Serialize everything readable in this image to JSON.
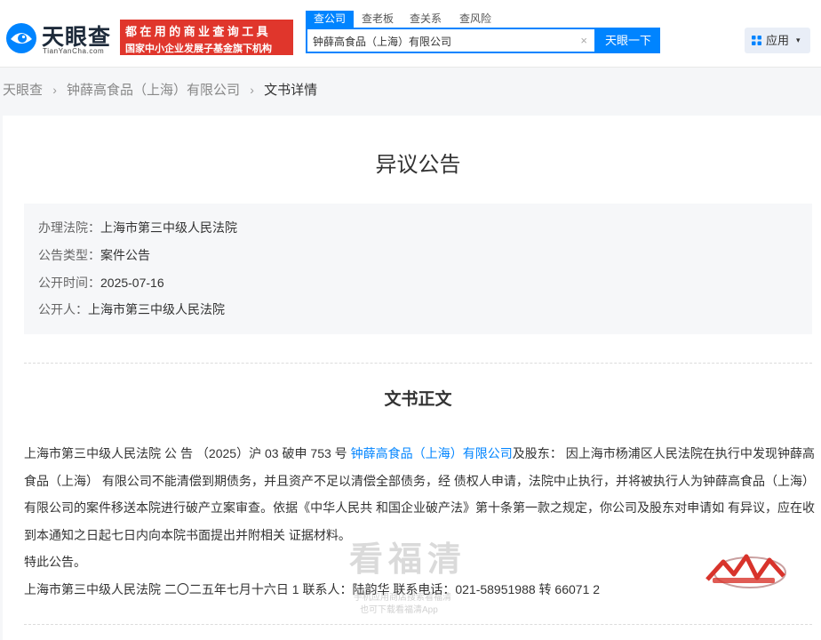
{
  "header": {
    "logo_text": "天眼查",
    "logo_sub": "TianYanCha.com",
    "slogan_line1": "都在用的商业查询工具",
    "slogan_line2": "国家中小企业发展子基金旗下机构",
    "search_tabs": [
      {
        "label": "查公司"
      },
      {
        "label": "查老板"
      },
      {
        "label": "查关系"
      },
      {
        "label": "查风险"
      }
    ],
    "search_value": "钟薛高食品（上海）有限公司",
    "clear_glyph": "×",
    "search_button": "天眼一下",
    "apps_button": "应用",
    "apps_caret": "▾"
  },
  "breadcrumb": {
    "items": [
      "天眼查",
      "钟薛高食品（上海）有限公司",
      "文书详情"
    ],
    "separator": "›"
  },
  "document": {
    "title": "异议公告",
    "meta": [
      {
        "key": "办理法院：",
        "value": "上海市第三中级人民法院"
      },
      {
        "key": "公告类型：",
        "value": "案件公告"
      },
      {
        "key": "公开时间：",
        "value": "2025-07-16"
      },
      {
        "key": "公开人：",
        "value": "上海市第三中级人民法院"
      }
    ],
    "section_title": "文书正文",
    "body": {
      "p1_before": "上海市第三中级人民法院 公 告 （2025）沪 03 破申 753 号 ",
      "p1_link": "钟薛高食品（上海）有限公司",
      "p1_after": "及股东：  因上海市杨浦区人民法院在执行中发现钟薛高食品（上海） 有限公司不能清偿到期债务，并且资产不足以清偿全部债务，经 债权人申请，法院中止执行，并将被执行人为钟薛高食品（上海） 有限公司的案件移送本院进行破产立案审查。依据《中华人民共 和国企业破产法》第十条第一款之规定，你公司及股东对申请如 有异议，应在收到本通知之日起七日内向本院书面提出并附相关 证据材料。",
      "p2": "特此公告。",
      "p3": "上海市第三中级人民法院 二〇二五年七月十六日 1 联系人：陆韵华 联系电话：021-58951988 转 66071 2"
    }
  },
  "watermark": {
    "chars": "看福清",
    "line1": "手机应用商店搜索看福清",
    "line2": "也可下载看福清App"
  },
  "colors": {
    "accent": "#0084ff",
    "slogan_bg": "#e0362c",
    "page_bg": "#f5f6f8",
    "meta_bg": "#f6f7f9"
  }
}
